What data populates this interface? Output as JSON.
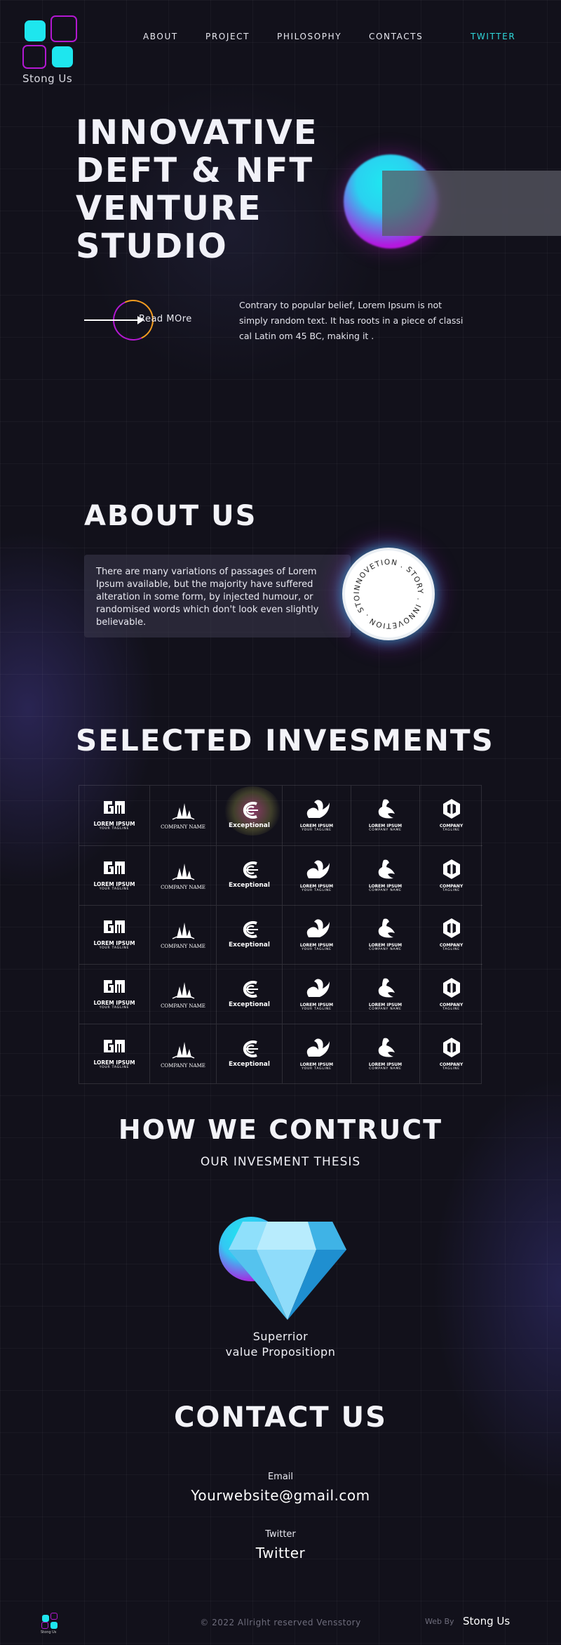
{
  "brand": {
    "name": "Stong Us"
  },
  "nav": {
    "about": "ABOUT",
    "project": "PROJECT",
    "philosophy": "PHILOSOPHY",
    "contacts": "CONTACTS",
    "twitter": "TWITTER"
  },
  "hero": {
    "title_lines": [
      "INNOVATIVE",
      "DEFT & NFT",
      "VENTURE",
      "STUDIO"
    ],
    "read_more": "Read MOre",
    "description": "Contrary to popular belief, Lorem Ipsum is not simply random text. It has roots in a piece of classi cal Latin om 45 BC, making it ."
  },
  "about": {
    "title": "ABOUT US",
    "text": "There are many variations of passages of Lorem Ipsum available, but the majority have suffered alteration in some form, by injected humour, or randomised words which don't look even slightly believable.",
    "badge_text": "INNOVETION . STORY . INNOVETION . STORY ."
  },
  "investments": {
    "title": "SELECTED INVESMENTS",
    "logos": [
      {
        "kind": "gm",
        "name": "LOREM IPSUM",
        "sub": "YOUR TAGLINE"
      },
      {
        "kind": "building",
        "name": "COMPANY NAME",
        "sub": ""
      },
      {
        "kind": "exceptional",
        "name": "Exceptional",
        "sub": ""
      },
      {
        "kind": "swan",
        "name": "LOREM IPSUM",
        "sub": "YOUR TAGLINE"
      },
      {
        "kind": "bird",
        "name": "LOREM IPSUM",
        "sub": "COMPANY NAME"
      },
      {
        "kind": "cube",
        "name": "COMPANY",
        "sub": "TAGLINE"
      }
    ],
    "rows": 5
  },
  "construct": {
    "title": "HOW WE CONTRUCT",
    "subtitle": "OUR INVESMENT THESIS",
    "item_line1": "Superrior",
    "item_line2": "value Propositiopn"
  },
  "contact": {
    "title": "CONTACT US",
    "email_label": "Email",
    "email_value": "Yourwebsite@gmail.com",
    "twitter_label": "Twitter",
    "twitter_value": "Twitter"
  },
  "footer": {
    "copyright": "©  2022 Allright reserved Vensstory",
    "web_by": "Web By",
    "brand": "Stong Us",
    "logo_text": "Stong Us"
  },
  "colors": {
    "accent_cyan": "#1ee6ee",
    "accent_magenta": "#b318d1",
    "accent_orange": "#f39b20",
    "background": "#12111b"
  }
}
